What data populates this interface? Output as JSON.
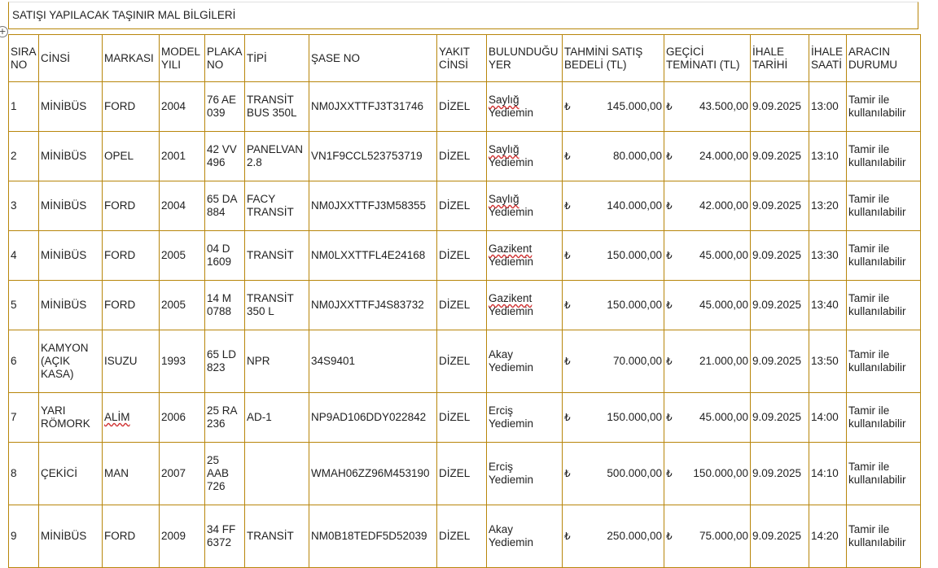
{
  "title": "SATIŞI YAPILACAK TAŞINIR MAL BİLGİLERİ",
  "headers": {
    "sira": "SIRA NO",
    "cinsi": "CİNSİ",
    "markasi": "MARKASI",
    "model": "MODEL YILI",
    "plaka": "PLAKA NO",
    "tipi": "TİPİ",
    "sase": "ŞASE NO",
    "yakit": "YAKIT CİNSİ",
    "yer": "BULUNDUĞU YER",
    "bedel": "TAHMİNİ SATIŞ BEDELİ (TL)",
    "teminat": "GEÇİCİ TEMİNATI (TL)",
    "tarih": "İHALE TARİHİ",
    "saat": "İHALE SAATİ",
    "durum": "ARACIN DURUMU"
  },
  "currency_symbol": "₺",
  "rows": [
    {
      "sira": "1",
      "cinsi": "MİNİBÜS",
      "markasi": "FORD",
      "model": "2004",
      "plaka": "76 AE 039",
      "tipi": "TRANSİT BUS 350L",
      "sase": "NM0JXXTTFJ3T31746",
      "yakit": "DİZEL",
      "yer_a": "Saylığ",
      "yer_b": "Yediemin",
      "bedel": "145.000,00",
      "teminat": "43.500,00",
      "tarih": "9.09.2025",
      "saat": "13:00",
      "durum": "Tamir ile kullanılabilir"
    },
    {
      "sira": "2",
      "cinsi": "MİNİBÜS",
      "markasi": "OPEL",
      "model": "2001",
      "plaka": "42 VV 496",
      "tipi": "PANELVAN 2.8",
      "sase": "VN1F9CCL523753719",
      "yakit": "DİZEL",
      "yer_a": "Saylığ",
      "yer_b": "Yediemin",
      "bedel": "80.000,00",
      "teminat": "24.000,00",
      "tarih": "9.09.2025",
      "saat": "13:10",
      "durum": "Tamir ile kullanılabilir"
    },
    {
      "sira": "3",
      "cinsi": "MİNİBÜS",
      "markasi": "FORD",
      "model": "2004",
      "plaka": "65 DA 884",
      "tipi": "FACY TRANSİT",
      "sase": "NM0JXXTTFJ3M58355",
      "yakit": "DİZEL",
      "yer_a": "Saylığ",
      "yer_b": "Yediemin",
      "bedel": "140.000,00",
      "teminat": "42.000,00",
      "tarih": "9.09.2025",
      "saat": "13:20",
      "durum": "Tamir ile kullanılabilir"
    },
    {
      "sira": "4",
      "cinsi": "MİNİBÜS",
      "markasi": "FORD",
      "model": "2005",
      "plaka": "04 D 1609",
      "tipi": "TRANSİT",
      "sase": "NM0LXXTTFL4E24168",
      "yakit": "DİZEL",
      "yer_a": "Gazikent",
      "yer_b": "Yediemin",
      "bedel": "150.000,00",
      "teminat": "45.000,00",
      "tarih": "9.09.2025",
      "saat": "13:30",
      "durum": "Tamir ile kullanılabilir"
    },
    {
      "sira": "5",
      "cinsi": "MİNİBÜS",
      "markasi": "FORD",
      "model": "2005",
      "plaka": "14 M 0788",
      "tipi": "TRANSİT 350 L",
      "sase": "NM0JXXTTFJ4S83732",
      "yakit": "DİZEL",
      "yer_a": "Gazikent",
      "yer_b": "Yediemin",
      "bedel": "150.000,00",
      "teminat": "45.000,00",
      "tarih": "9.09.2025",
      "saat": "13:40",
      "durum": "Tamir ile kullanılabilir"
    },
    {
      "sira": "6",
      "cinsi": "KAMYON (AÇIK KASA)",
      "markasi": "ISUZU",
      "model": "1993",
      "plaka": "65 LD 823",
      "tipi": "NPR",
      "sase": "34S9401",
      "yakit": "DİZEL",
      "yer_a": "Akay",
      "yer_b": "Yediemin",
      "bedel": "70.000,00",
      "teminat": "21.000,00",
      "tarih": "9.09.2025",
      "saat": "13:50",
      "durum": "Tamir ile kullanılabilir"
    },
    {
      "sira": "7",
      "cinsi": "YARI RÖMORK",
      "markasi": "ALİM",
      "model": "2006",
      "plaka": "25 RA 236",
      "tipi": "AD-1",
      "sase": "NP9AD106DDY022842",
      "yakit": "DİZEL",
      "yer_a": "Erciş",
      "yer_b": "Yediemin",
      "bedel": "150.000,00",
      "teminat": "45.000,00",
      "tarih": "9.09.2025",
      "saat": "14:00",
      "durum": "Tamir ile kullanılabilir"
    },
    {
      "sira": "8",
      "cinsi": "ÇEKİCİ",
      "markasi": "MAN",
      "model": "2007",
      "plaka": "25 AAB 726",
      "tipi": "",
      "sase": "WMAH06ZZ96M453190",
      "yakit": "DİZEL",
      "yer_a": "Erciş",
      "yer_b": "Yediemin",
      "bedel": "500.000,00",
      "teminat": "150.000,00",
      "tarih": "9.09.2025",
      "saat": "14:10",
      "durum": "Tamir ile kullanılabilir"
    },
    {
      "sira": "9",
      "cinsi": "MİNİBÜS",
      "markasi": "FORD",
      "model": "2009",
      "plaka": "34 FF 6372",
      "tipi": "TRANSİT",
      "sase": "NM0B18TEDF5D52039",
      "yakit": "DİZEL",
      "yer_a": "Akay",
      "yer_b": "Yediemin",
      "bedel": "250.000,00",
      "teminat": "75.000,00",
      "tarih": "9.09.2025",
      "saat": "14:20",
      "durum": "Tamir ile kullanılabilir"
    }
  ]
}
